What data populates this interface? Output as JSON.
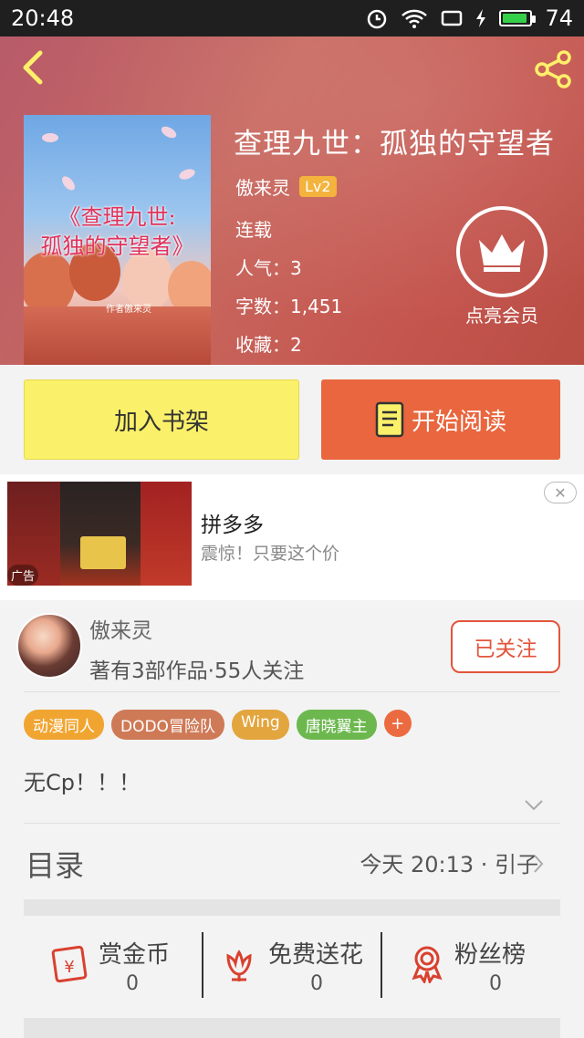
{
  "status_bar": {
    "time": "20:48",
    "battery": "74"
  },
  "book": {
    "title": "查理九世：孤独的守望者",
    "author": "傲来灵",
    "author_level": "Lv2",
    "status": "连载",
    "popularity": "人气：3",
    "word_count": "字数：1,451",
    "favorites": "收藏：2",
    "cover_title_line1": "《查理九世:",
    "cover_title_line2": "孤独的守望者》",
    "cover_small_text": "作者傲来灵"
  },
  "vip": {
    "label": "点亮会员"
  },
  "actions": {
    "add_shelf": "加入书架",
    "start_reading": "开始阅读"
  },
  "ad": {
    "title": "拼多多",
    "subtitle": "震惊！只要这个价",
    "tag": "广告",
    "close": "✕"
  },
  "author_card": {
    "name": "傲来灵",
    "stats": "著有3部作品·55人关注",
    "follow_label": "已关注",
    "tags": [
      "动漫同人",
      "DODO冒险队",
      "Wing",
      "唐晓翼主"
    ],
    "tag_colors": [
      "#f1a531",
      "#cf7a57",
      "#e3a53e",
      "#6cb84f"
    ],
    "add_tag": "+",
    "description": "无Cp！！！"
  },
  "catalog": {
    "label": "目录",
    "latest": "今天 20:13 · 引子"
  },
  "bottom_stats": [
    {
      "label": "赏金币",
      "value": "0",
      "icon": "coin-envelope-icon"
    },
    {
      "label": "免费送花",
      "value": "0",
      "icon": "flower-icon"
    },
    {
      "label": "粉丝榜",
      "value": "0",
      "icon": "medal-icon"
    }
  ],
  "colors": {
    "accent": "#e9663e",
    "shelf_button": "#fbf06a",
    "icon_red": "#d9412f"
  }
}
